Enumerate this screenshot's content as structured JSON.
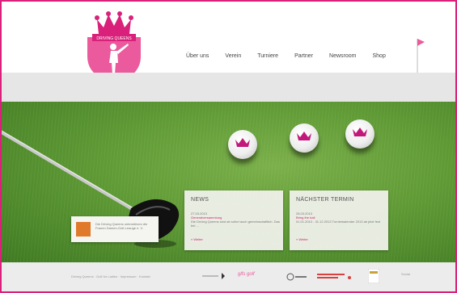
{
  "nav": {
    "items": [
      "Über uns",
      "Verein",
      "Turniere",
      "Partner",
      "Newsroom",
      "Shop"
    ]
  },
  "news": {
    "title": "NEWS",
    "date": "27.03.2013",
    "headline": "Generalversammlung",
    "body": "Die Driving Queens sind ab sofort auch gemeinschaftlich. Das bei ...",
    "more": "» Weiter"
  },
  "termin": {
    "title": "NÄCHSTER TERMIN",
    "date": "28.03.2013",
    "headline": "Bring the ball",
    "body": "01.01.2013 - 31.12.2013 Turnierkalender 2013 ab jetzt fest",
    "more": "» Weiter"
  },
  "tooltip": {
    "text": "Die Driving Queens unterstützen die Frauen Damen-Golf-Leauge e. V."
  },
  "footer": {
    "left_text": "Driving Queens · Golf for Ladies · Impressum · Kontakt",
    "sponsor_golf": "glfs golf",
    "social_label": "Social"
  },
  "colors": {
    "accent": "#d9207a",
    "grass": "#5f9a35"
  }
}
